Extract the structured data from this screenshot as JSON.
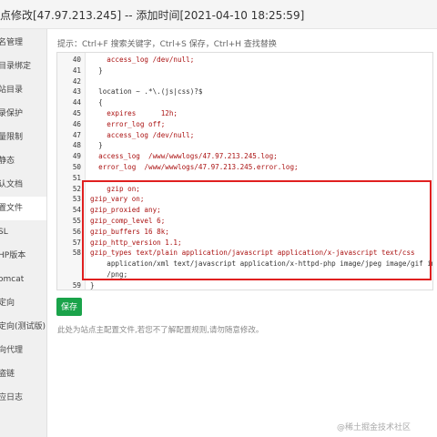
{
  "window": {
    "title": "点修改[47.97.213.245] -- 添加时间[2021-04-10 18:25:59]"
  },
  "sidebar": {
    "items": [
      {
        "label": "名管理"
      },
      {
        "label": "目录绑定"
      },
      {
        "label": "站目录"
      },
      {
        "label": "录保护"
      },
      {
        "label": "量限制"
      },
      {
        "label": "静态"
      },
      {
        "label": "认文档"
      },
      {
        "label": "置文件"
      },
      {
        "label": "SL"
      },
      {
        "label": "HP版本"
      },
      {
        "label": "omcat"
      },
      {
        "label": "定向"
      },
      {
        "label": "定向(测试版)"
      },
      {
        "label": "向代理"
      },
      {
        "label": "盗链"
      },
      {
        "label": "应日志"
      }
    ]
  },
  "hint": "提示：Ctrl+F 搜索关键字，Ctrl+S 保存，Ctrl+H 查找替换",
  "editor": {
    "lines": [
      {
        "n": "40",
        "t": "    access_log /dev/null;"
      },
      {
        "n": "41",
        "t": "  }"
      },
      {
        "n": "42",
        "t": ""
      },
      {
        "n": "43",
        "t": "  location ~ .*\\.(js|css)?$"
      },
      {
        "n": "44",
        "t": "  {"
      },
      {
        "n": "45",
        "t": "    expires      12h;"
      },
      {
        "n": "46",
        "t": "    error_log off;"
      },
      {
        "n": "47",
        "t": "    access_log /dev/null;"
      },
      {
        "n": "48",
        "t": "  }"
      },
      {
        "n": "49",
        "t": "  access_log  /www/wwwlogs/47.97.213.245.log;"
      },
      {
        "n": "50",
        "t": "  error_log  /www/wwwlogs/47.97.213.245.error.log;"
      },
      {
        "n": "51",
        "t": ""
      },
      {
        "n": "52",
        "t": "    gzip on;"
      },
      {
        "n": "53",
        "t": "gzip_vary on;"
      },
      {
        "n": "54",
        "t": "gzip_proxied any;"
      },
      {
        "n": "55",
        "t": "gzip_comp_level 6;"
      },
      {
        "n": "56",
        "t": "gzip_buffers 16 8k;"
      },
      {
        "n": "57",
        "t": "gzip_http_version 1.1;"
      },
      {
        "n": "58",
        "t": "gzip_types text/plain application/javascript application/x-javascript text/css"
      },
      {
        "n": "",
        "t": "    application/xml text/javascript application/x-httpd-php image/jpeg image/gif image"
      },
      {
        "n": "",
        "t": "    /png;"
      },
      {
        "n": "59",
        "t": "}"
      }
    ]
  },
  "save_label": "保存",
  "note": "此处为站点主配置文件,若您不了解配置规则,请勿随意修改。",
  "watermark": "@稀土掘金技术社区"
}
